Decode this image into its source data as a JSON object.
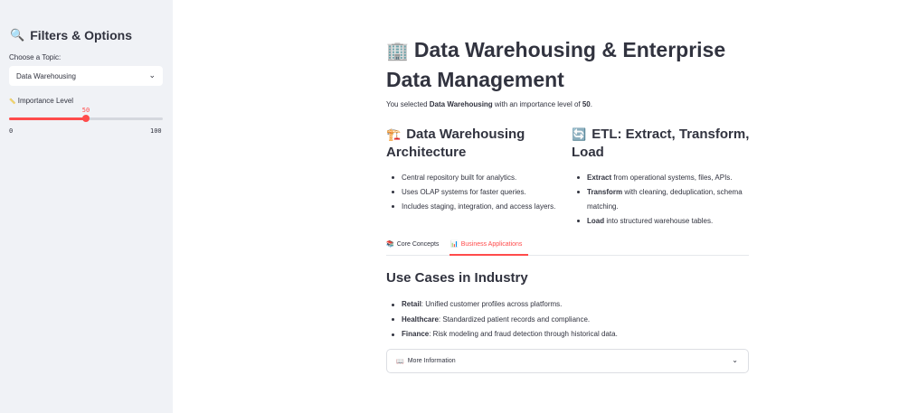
{
  "sidebar": {
    "title": "Filters & Options",
    "title_icon": "🔍",
    "topic_label": "Choose a Topic:",
    "topic_value": "Data Warehousing",
    "importance_label": "Importance Level",
    "importance_icon": "📏",
    "slider": {
      "value": "50",
      "min": "0",
      "max": "100",
      "fraction": 0.5
    }
  },
  "main": {
    "title": "Data Warehousing & Enterprise Data Management",
    "title_icon": "🏢",
    "intro": {
      "prefix": "You selected ",
      "topic": "Data Warehousing",
      "middle": " with an importance level of ",
      "level": "50",
      "suffix": "."
    },
    "architecture": {
      "icon": "🏗️",
      "heading": "Data Warehousing Architecture",
      "items": [
        "Central repository built for analytics.",
        "Uses OLAP systems for faster queries.",
        "Includes staging, integration, and access layers."
      ]
    },
    "etl": {
      "icon": "🔄",
      "heading": "ETL: Extract, Transform, Load",
      "items": [
        {
          "bold": "Extract",
          "text": " from operational systems, files, APIs."
        },
        {
          "bold": "Transform",
          "text": " with cleaning, deduplication, schema matching."
        },
        {
          "bold": "Load",
          "text": " into structured warehouse tables."
        }
      ]
    },
    "tabs": [
      {
        "icon": "📚",
        "label": "Core Concepts"
      },
      {
        "icon": "📊",
        "label": "Business Applications"
      }
    ],
    "use_cases": {
      "heading": "Use Cases in Industry",
      "items": [
        {
          "bold": "Retail",
          "text": ": Unified customer profiles across platforms."
        },
        {
          "bold": "Healthcare",
          "text": ": Standardized patient records and compliance."
        },
        {
          "bold": "Finance",
          "text": ": Risk modeling and fraud detection through historical data."
        }
      ]
    },
    "expander": {
      "icon": "📖",
      "label": "More Information"
    }
  },
  "colors": {
    "accent": "#ff4b4b",
    "sidebar_bg": "#f0f2f6",
    "text": "#31333f"
  }
}
